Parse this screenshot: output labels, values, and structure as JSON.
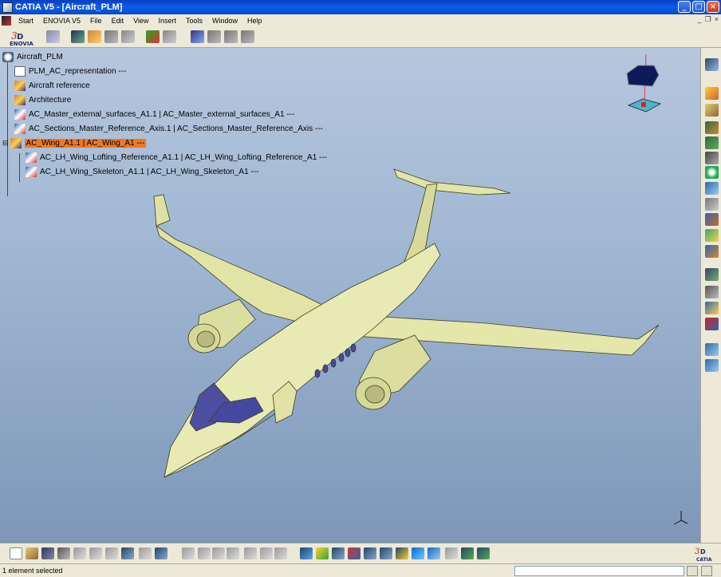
{
  "window": {
    "title": "CATIA V5 - [Aircraft_PLM]",
    "controls": {
      "minimize": "_",
      "maximize": "□",
      "close": "×"
    }
  },
  "menubar": {
    "items": [
      "Start",
      "ENOVIA V5",
      "File",
      "Edit",
      "View",
      "Insert",
      "Tools",
      "Window",
      "Help"
    ],
    "mdi": {
      "minimize": "_",
      "restore": "❐",
      "close": "×"
    }
  },
  "tree": {
    "root": "Aircraft_PLM",
    "nodes": [
      {
        "label": "PLM_AC_representation ---",
        "icon": "document-icon"
      },
      {
        "label": "Aircraft reference",
        "icon": "product-icon"
      },
      {
        "label": "Architecture",
        "icon": "product-icon"
      },
      {
        "label": "AC_Master_external_surfaces_A1.1 | AC_Master_external_surfaces_A1 ---",
        "icon": "part-instance-icon"
      },
      {
        "label": "AC_Sections_Master_Reference_Axis.1 | AC_Sections_Master_Reference_Axis ---",
        "icon": "part-instance-icon"
      },
      {
        "label": "AC_Wing_A1.1 | AC_Wing_A1 ---",
        "icon": "product-icon",
        "selected": true
      },
      {
        "label": "AC_LH_Wing_Lofting_Reference_A1.1 | AC_LH_Wing_Lofting_Reference_A1 ---",
        "icon": "part-instance-icon"
      },
      {
        "label": "AC_LH_Wing_Skeleton_A1.1 | AC_LH_Wing_Skeleton_A1 ---",
        "icon": "part-instance-icon"
      }
    ]
  },
  "status": {
    "text": "1 element selected",
    "command_value": ""
  },
  "logos": {
    "top": "ENOVIA",
    "bottom": "CATIA"
  },
  "colors": {
    "selection": "#f07820",
    "aircraft_skin": "#e6e8b0",
    "canopy": "#4c4ea0",
    "viewport_top": "#b6c7dd",
    "viewport_bottom": "#7e97b9",
    "titlebar": "#0b5ee8"
  }
}
